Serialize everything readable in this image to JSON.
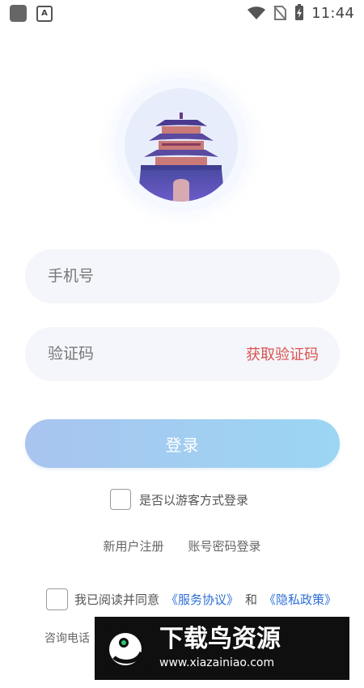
{
  "status_bar": {
    "time": "11:44",
    "app_badge": "A",
    "icons": [
      "square-icon",
      "a-badge-icon",
      "wifi-icon",
      "no-sim-icon",
      "battery-charging-icon"
    ]
  },
  "form": {
    "phone_placeholder": "手机号",
    "code_placeholder": "验证码",
    "get_code_label": "获取验证码",
    "login_label": "登录"
  },
  "options": {
    "guest_login_label": "是否以游客方式登录",
    "new_user_label": "新用户注册",
    "password_login_label": "账号密码登录",
    "agree_prefix": "我已阅读并同意",
    "service_agreement": "《服务协议》",
    "and_text": "和",
    "privacy_policy": "《隐私政策》",
    "consult_label": "咨询电话"
  },
  "watermark": {
    "title": "下载鸟资源",
    "url": "www.xiazainiao.com"
  },
  "colors": {
    "accent_red": "#d9534f",
    "link_blue": "#2f6fd6",
    "button_start": "#a8c4ef",
    "button_end": "#9bd6f3"
  }
}
